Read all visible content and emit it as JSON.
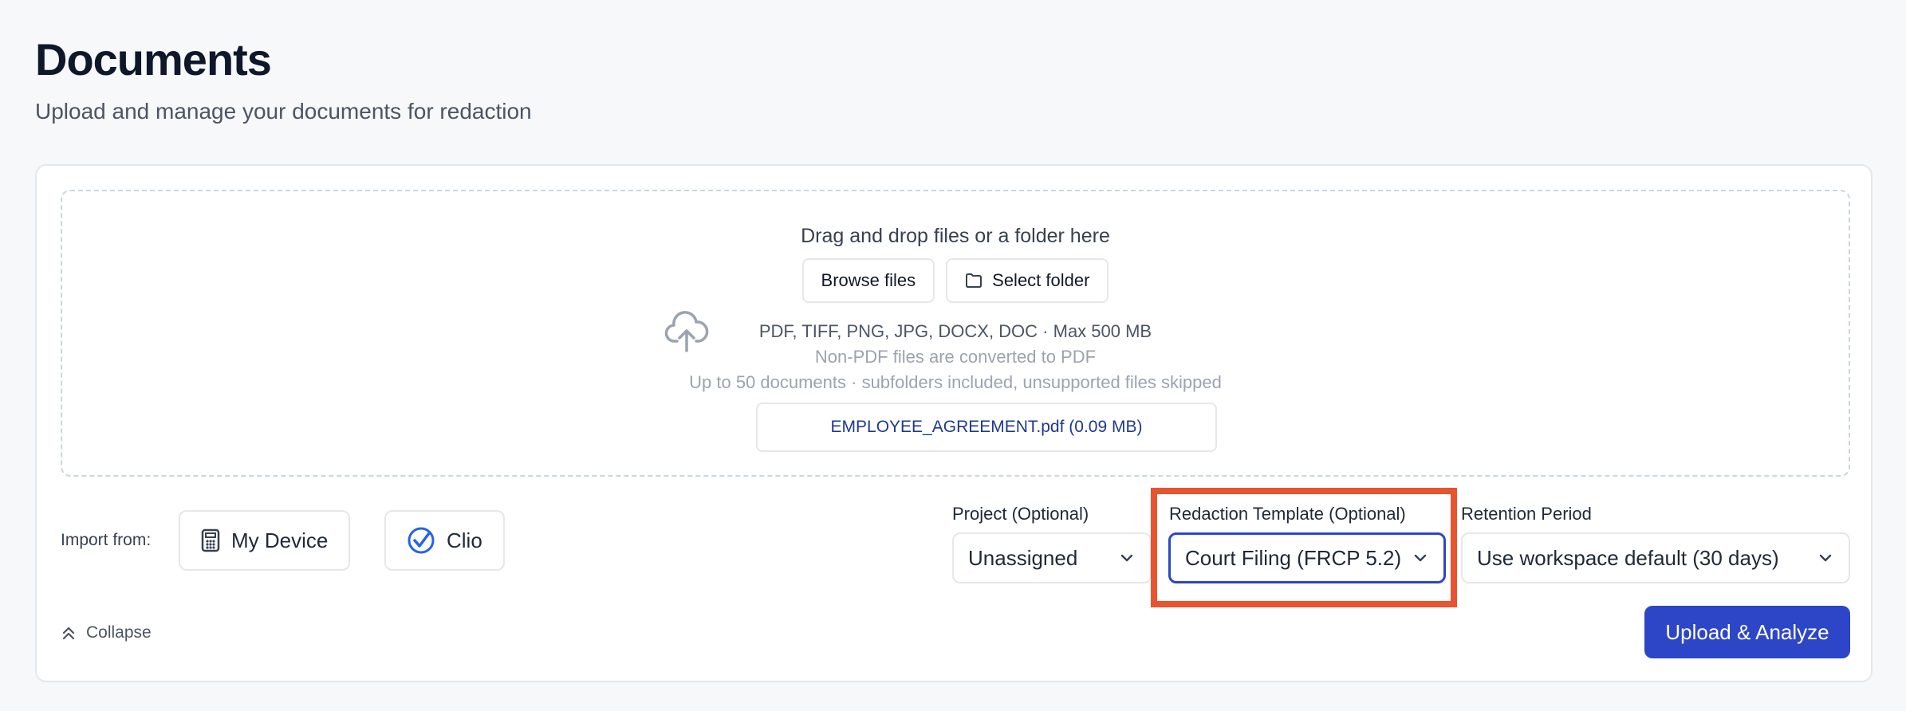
{
  "header": {
    "title": "Documents",
    "subtitle": "Upload and manage your documents for redaction"
  },
  "dropzone": {
    "heading": "Drag and drop files or a folder here",
    "browse_label": "Browse files",
    "select_folder_label": "Select folder",
    "formats": "PDF, TIFF, PNG, JPG, DOCX, DOC · Max 500 MB",
    "conversion_note": "Non-PDF files are converted to PDF",
    "limits_note": "Up to 50 documents · subfolders included, unsupported files skipped",
    "selected_file": "EMPLOYEE_AGREEMENT.pdf (0.09 MB)",
    "upload_icon": "cloud-upload-icon",
    "folder_icon": "folder-icon"
  },
  "import": {
    "label": "Import from:",
    "sources": [
      {
        "label": "My Device",
        "icon": "calculator-device-icon"
      },
      {
        "label": "Clio",
        "icon": "clio-check-icon"
      }
    ]
  },
  "fields": {
    "project": {
      "label": "Project (Optional)",
      "value": "Unassigned"
    },
    "template": {
      "label": "Redaction Template (Optional)",
      "value": "Court Filing (FRCP 5.2)"
    },
    "retention": {
      "label": "Retention Period",
      "value": "Use workspace default (30 days)"
    }
  },
  "footer": {
    "collapse_label": "Collapse",
    "submit_label": "Upload & Analyze"
  },
  "colors": {
    "primary": "#2d46c8",
    "highlight": "#e8542f",
    "file_text": "#1e3a8a"
  }
}
